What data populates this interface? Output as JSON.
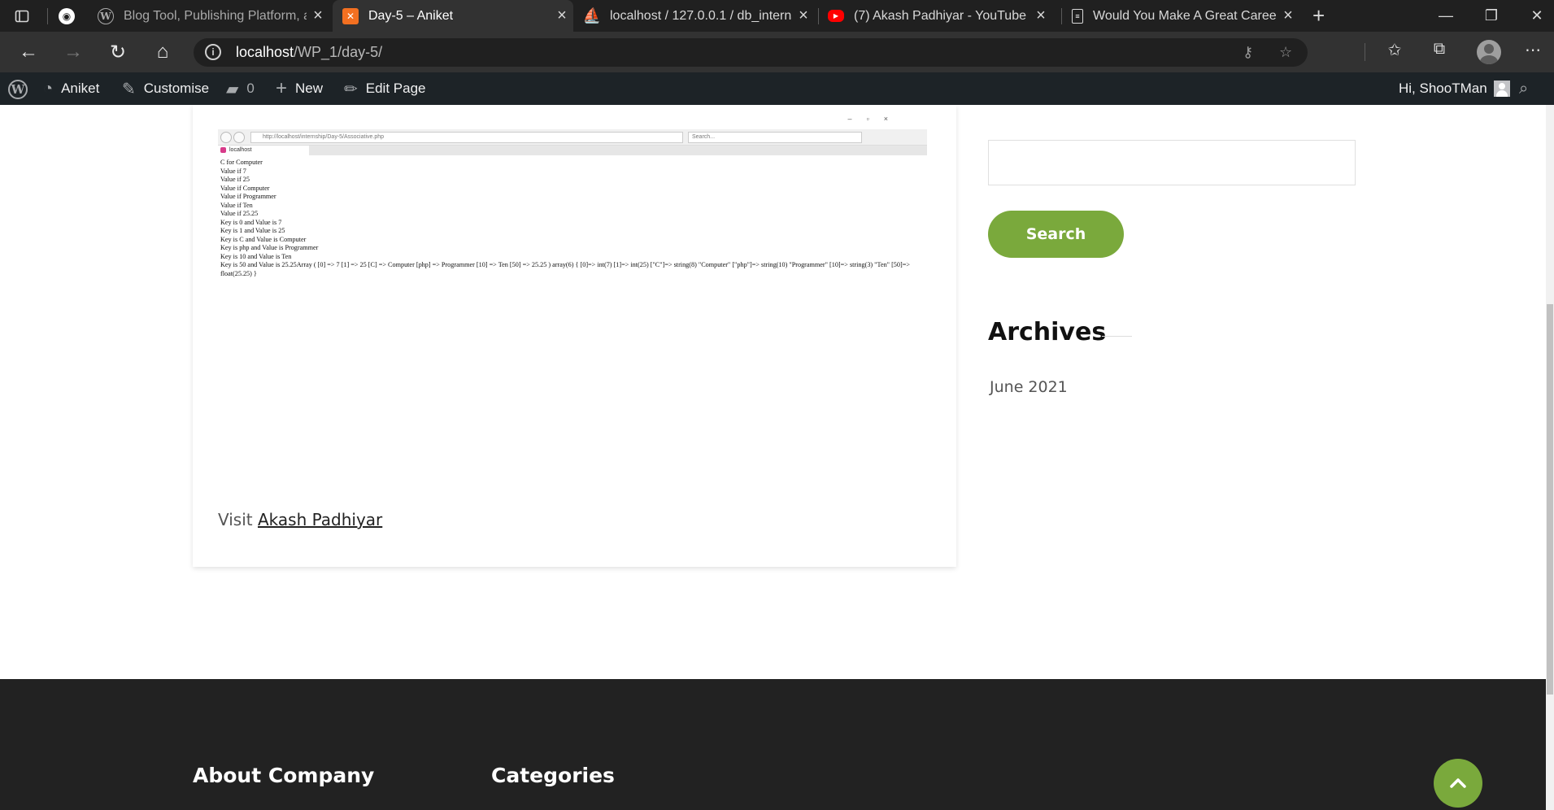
{
  "browser": {
    "tabs": [
      {
        "title": "Blog Tool, Publishing Platform, a",
        "active": false
      },
      {
        "title": "Day-5 – Aniket",
        "active": true
      },
      {
        "title": "localhost / 127.0.0.1 / db_interns",
        "active": false
      },
      {
        "title": "(7) Akash Padhiyar - YouTube",
        "active": false
      },
      {
        "title": "Would You Make A Great Career",
        "active": false
      }
    ],
    "new_tab": "+",
    "url_host": "localhost",
    "url_path": "/WP_1/day-5/"
  },
  "adminbar": {
    "site": "Aniket",
    "customise": "Customise",
    "comments": "0",
    "new": "New",
    "edit": "Edit Page",
    "greeting": "Hi, ShooTMan"
  },
  "embedded_screenshot": {
    "url": "http://localhost/internship/Day-5/Associative.php",
    "search_placeholder": "Search...",
    "tab_title": "localhost",
    "lines": [
      "C for Computer",
      "Value if 7",
      "Value if 25",
      "Value if Computer",
      "Value if Programmer",
      "Value if Ten",
      "Value if 25.25",
      "Key is 0 and Value is 7",
      "Key is 1 and Value is 25",
      "Key is C and Value is Computer",
      "Key is php and Value is Programmer",
      "Key is 10 and Value is Ten"
    ],
    "last_line": "Key is 50 and Value is 25.25Array ( [0] => 7 [1] => 25 [C] => Computer [php] => Programmer [10] => Ten [50] => 25.25 ) array(6) { [0]=> int(7) [1]=> int(25) [\"C\"]=> string(8) \"Computer\" [\"php\"]=> string(10) \"Programmer\" [10]=> string(3) \"Ten\" [50]=> float(25.25) }"
  },
  "article": {
    "visit_prefix": "Visit",
    "visit_link": "Akash Padhiyar"
  },
  "sidebar": {
    "search_button": "Search",
    "archives_title": "Archives",
    "archive_items": [
      "June 2021"
    ]
  },
  "footer": {
    "about_title": "About Company",
    "categories_title": "Categories"
  },
  "colors": {
    "accent": "#7aa93c",
    "adminbar": "#1d2327",
    "footer": "#222222"
  }
}
